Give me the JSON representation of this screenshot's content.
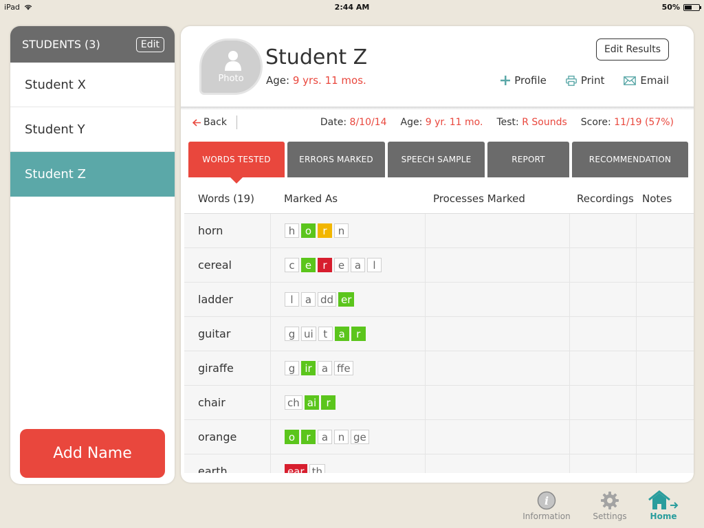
{
  "status_bar": {
    "device": "iPad",
    "time": "2:44 AM",
    "battery": "50%",
    "battery_level": 0.5
  },
  "sidebar": {
    "title": "STUDENTS (3)",
    "edit_label": "Edit",
    "students": [
      {
        "name": "Student X",
        "selected": false
      },
      {
        "name": "Student Y",
        "selected": false
      },
      {
        "name": "Student Z",
        "selected": true
      }
    ],
    "add_name_label": "Add Name"
  },
  "profile": {
    "photo_label": "Photo",
    "name": "Student Z",
    "age_label": "Age:",
    "age_value": "9 yrs. 11 mos.",
    "edit_results_label": "Edit Results",
    "actions": {
      "profile": "Profile",
      "print": "Print",
      "email": "Email"
    }
  },
  "info": {
    "back_label": "Back",
    "date_label": "Date:",
    "date_value": "8/10/14",
    "age_label": "Age:",
    "age_value": "9 yr. 11 mo.",
    "test_label": "Test:",
    "test_value": "R Sounds",
    "score_label": "Score:",
    "score_value": "11/19 (57%)"
  },
  "tabs": [
    {
      "label": "WORDS TESTED",
      "active": true
    },
    {
      "label": "ERRORS MARKED",
      "active": false
    },
    {
      "label": "SPEECH SAMPLE",
      "active": false
    },
    {
      "label": "REPORT",
      "active": false
    },
    {
      "label": "RECOMMENDATION",
      "active": false
    }
  ],
  "table": {
    "headers": {
      "words": "Words (19)",
      "marked_as": "Marked As",
      "processes": "Processes Marked",
      "recordings": "Recordings",
      "notes": "Notes"
    },
    "rows": [
      {
        "word": "horn",
        "tiles": [
          {
            "t": "h",
            "s": "plain"
          },
          {
            "t": "o",
            "s": "green"
          },
          {
            "t": "r",
            "s": "yellow"
          },
          {
            "t": "n",
            "s": "plain"
          }
        ]
      },
      {
        "word": "cereal",
        "tiles": [
          {
            "t": "c",
            "s": "plain"
          },
          {
            "t": "e",
            "s": "green"
          },
          {
            "t": "r",
            "s": "red"
          },
          {
            "t": "e",
            "s": "plain"
          },
          {
            "t": "a",
            "s": "plain"
          },
          {
            "t": "l",
            "s": "plain"
          }
        ]
      },
      {
        "word": "ladder",
        "tiles": [
          {
            "t": "l",
            "s": "plain"
          },
          {
            "t": "a",
            "s": "plain"
          },
          {
            "t": "dd",
            "s": "plain"
          },
          {
            "t": "er",
            "s": "green"
          }
        ]
      },
      {
        "word": "guitar",
        "tiles": [
          {
            "t": "g",
            "s": "plain"
          },
          {
            "t": "ui",
            "s": "plain"
          },
          {
            "t": "t",
            "s": "plain"
          },
          {
            "t": "a",
            "s": "green"
          },
          {
            "t": "r",
            "s": "green"
          }
        ]
      },
      {
        "word": "giraffe",
        "tiles": [
          {
            "t": "g",
            "s": "plain"
          },
          {
            "t": "ir",
            "s": "green"
          },
          {
            "t": "a",
            "s": "plain"
          },
          {
            "t": "ffe",
            "s": "plain"
          }
        ]
      },
      {
        "word": "chair",
        "tiles": [
          {
            "t": "ch",
            "s": "plain"
          },
          {
            "t": "ai",
            "s": "green"
          },
          {
            "t": "r",
            "s": "green"
          }
        ]
      },
      {
        "word": "orange",
        "tiles": [
          {
            "t": "o",
            "s": "green"
          },
          {
            "t": "r",
            "s": "green"
          },
          {
            "t": "a",
            "s": "plain"
          },
          {
            "t": "n",
            "s": "plain"
          },
          {
            "t": "ge",
            "s": "plain"
          }
        ]
      },
      {
        "word": "earth",
        "tiles": [
          {
            "t": "ear",
            "s": "red"
          },
          {
            "t": "th",
            "s": "plain"
          }
        ]
      }
    ]
  },
  "bottom_nav": {
    "information": "Information",
    "settings": "Settings",
    "home": "Home"
  },
  "colors": {
    "accent": "#e9473d",
    "teal": "#5ba8a8",
    "header_gray": "#6b6b6b",
    "tile_green": "#5bc51c",
    "tile_yellow": "#f2b600",
    "tile_red": "#d71e2e"
  }
}
